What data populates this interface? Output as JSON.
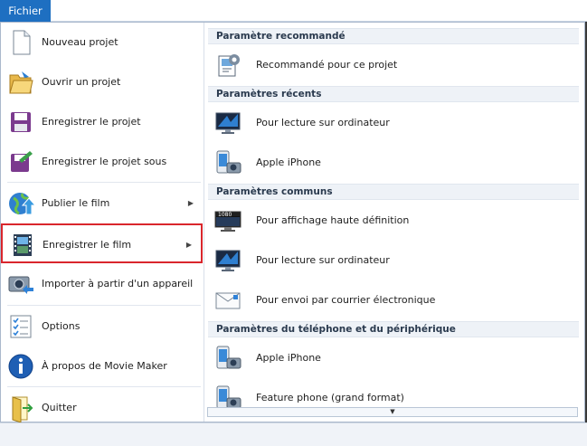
{
  "tab": {
    "label": "Fichier"
  },
  "left_menu": [
    {
      "label": "Nouveau projet",
      "icon": "new-document-icon",
      "submenu": false
    },
    {
      "label": "Ouvrir un projet",
      "icon": "open-folder-icon",
      "submenu": false
    },
    {
      "label": "Enregistrer le projet",
      "icon": "save-disk-icon",
      "submenu": false
    },
    {
      "label": "Enregistrer le projet sous",
      "icon": "save-as-icon",
      "submenu": false
    },
    {
      "label": "Publier le film",
      "icon": "globe-publish-icon",
      "submenu": true
    },
    {
      "label": "Enregistrer le film",
      "icon": "film-strip-icon",
      "submenu": true,
      "highlighted": true
    },
    {
      "label": "Importer à partir d'un appareil",
      "icon": "camera-import-icon",
      "submenu": false
    },
    {
      "label": "Options",
      "icon": "options-list-icon",
      "submenu": false
    },
    {
      "label": "À propos de Movie Maker",
      "icon": "info-icon",
      "submenu": false
    },
    {
      "label": "Quitter",
      "icon": "exit-door-icon",
      "submenu": false
    }
  ],
  "right_panel": {
    "sections": [
      {
        "title": "Paramètre recommandé",
        "items": [
          {
            "label": "Recommandé pour ce projet",
            "icon": "recommended-settings-icon"
          }
        ]
      },
      {
        "title": "Paramètres récents",
        "items": [
          {
            "label": "Pour lecture sur ordinateur",
            "icon": "computer-monitor-icon"
          },
          {
            "label": "Apple iPhone",
            "icon": "phone-camera-icon"
          }
        ]
      },
      {
        "title": "Paramètres communs",
        "items": [
          {
            "label": "Pour affichage haute définition",
            "icon": "hd-1080-monitor-icon"
          },
          {
            "label": "Pour lecture sur ordinateur",
            "icon": "computer-monitor-icon"
          },
          {
            "label": "Pour envoi par courrier électronique",
            "icon": "email-envelope-icon"
          }
        ]
      },
      {
        "title": "Paramètres du téléphone et du périphérique",
        "items": [
          {
            "label": "Apple iPhone",
            "icon": "phone-camera-icon"
          },
          {
            "label": "Feature phone (grand format)",
            "icon": "phone-camera-icon"
          }
        ]
      }
    ],
    "hd_badge": "1080"
  },
  "colors": {
    "tab": "#1e6fc1",
    "highlight_border": "#d9262c",
    "section_bg": "#eef2f7"
  }
}
